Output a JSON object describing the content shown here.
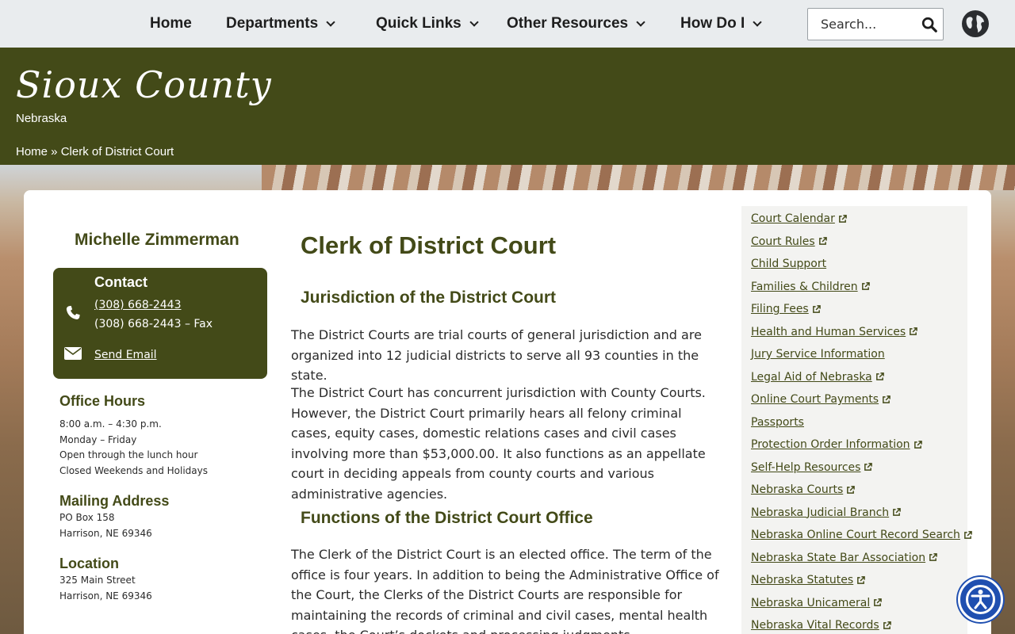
{
  "nav": {
    "items": [
      {
        "label": "Home",
        "has_dropdown": false
      },
      {
        "label": "Departments",
        "has_dropdown": true
      },
      {
        "label": "Quick Links",
        "has_dropdown": true
      },
      {
        "label": "Other Resources",
        "has_dropdown": true
      },
      {
        "label": "How Do I",
        "has_dropdown": true
      }
    ],
    "search_placeholder": "Search...",
    "search_icon": "search-icon",
    "language_icon": "globe-icon"
  },
  "banner": {
    "title": "Sioux County",
    "subtitle": "Nebraska",
    "breadcrumb_home": "Home",
    "breadcrumb_sep": " » ",
    "breadcrumb_current": "Clerk of District Court",
    "color": "#434a18"
  },
  "sidebar": {
    "person": "Michelle Zimmerman",
    "contact": {
      "heading": "Contact",
      "phone": "(308) 668-2443",
      "fax": "(308) 668-2443 – Fax",
      "email_label": "Send Email"
    },
    "office_hours": {
      "heading": "Office Hours",
      "lines": [
        "8:00 a.m. – 4:30 p.m.",
        "Monday – Friday",
        "Open through the lunch hour",
        "Closed Weekends and Holidays"
      ]
    },
    "mailing": {
      "heading": "Mailing Address",
      "lines": [
        "PO Box 158",
        "Harrison, NE 69346"
      ]
    },
    "location": {
      "heading": "Location",
      "lines": [
        "325 Main Street",
        "Harrison, NE 69346"
      ]
    }
  },
  "main": {
    "title": "Clerk of District Court",
    "sections": [
      {
        "heading": "Jurisdiction of the District Court"
      },
      {
        "heading": "Functions of the District Court Office"
      }
    ],
    "paragraphs": [
      "The District Courts are trial courts of general jurisdiction and are organized into 12 judicial districts to serve all 93 counties in the state.",
      "The District Court has concurrent jurisdiction with County Courts. However, the District Court primarily hears all felony criminal cases, equity cases, domestic relations cases and civil cases involving more than $53,000.00. It also functions as an appellate court in deciding appeals from county courts and various administrative agencies.",
      "The Clerk of the District Court is an elected office. The term of the office is four years.  In addition to being the Administrative Office of the Court, the Clerks of the District Courts are responsible for maintaining the records of criminal and civil cases, mental health cases, the Court’s dockets and processing judgments."
    ]
  },
  "links": [
    {
      "label": "Court Calendar",
      "external": true
    },
    {
      "label": "Court Rules",
      "external": true
    },
    {
      "label": "Child Support",
      "external": false
    },
    {
      "label": "Families & Children",
      "external": true
    },
    {
      "label": "Filing Fees",
      "external": true
    },
    {
      "label": "Health and Human Services",
      "external": true
    },
    {
      "label": "Jury Service Information",
      "external": false
    },
    {
      "label": "Legal Aid of Nebraska",
      "external": true
    },
    {
      "label": "Online Court Payments",
      "external": true
    },
    {
      "label": "Passports",
      "external": false
    },
    {
      "label": "Protection Order Information",
      "external": true
    },
    {
      "label": "Self-Help Resources",
      "external": true
    },
    {
      "label": "Nebraska Courts",
      "external": true
    },
    {
      "label": "Nebraska Judicial Branch",
      "external": true
    },
    {
      "label": "Nebraska Online Court Record Search",
      "external": true
    },
    {
      "label": "Nebraska State Bar Association",
      "external": true
    },
    {
      "label": "Nebraska Statutes",
      "external": true
    },
    {
      "label": "Nebraska Unicameral",
      "external": true
    },
    {
      "label": "Nebraska Vital Records",
      "external": true
    }
  ],
  "accessibility_icon": "accessibility-icon"
}
